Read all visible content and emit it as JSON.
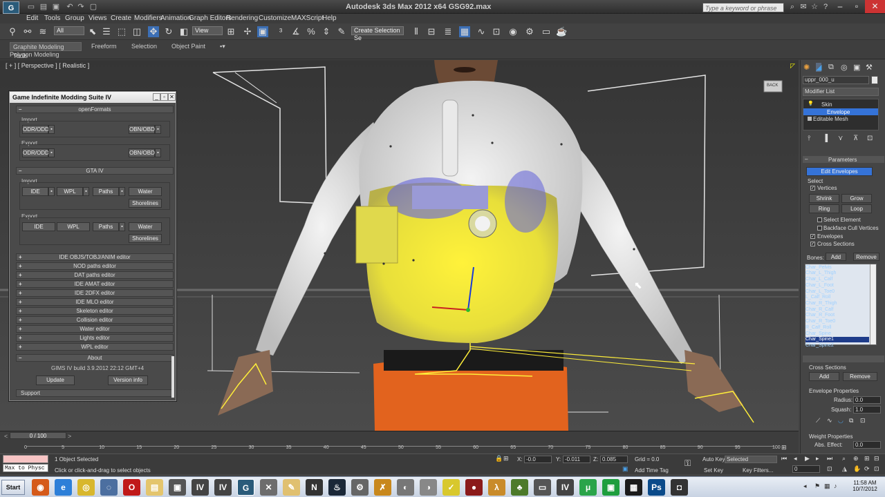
{
  "window": {
    "title": "Autodesk 3ds Max  2012 x64      GSG92.max",
    "app_icon": "3ds-max-logo",
    "search_placeholder": "Type a keyword or phrase"
  },
  "menu": [
    "Edit",
    "Tools",
    "Group",
    "Views",
    "Create",
    "Modifiers",
    "Animation",
    "Graph Editors",
    "Rendering",
    "Customize",
    "MAXScript",
    "Help"
  ],
  "toolbar": {
    "selection_filter": "All",
    "ref_coord": "View",
    "named_selection": "Create Selection Se"
  },
  "ribbon": {
    "tabs": [
      "Graphite Modeling Tools",
      "Freeform",
      "Selection",
      "Object Paint"
    ],
    "sub_label": "Polygon Modeling"
  },
  "viewport": {
    "label": "[ + ] [ Perspective ] [ Realistic ]",
    "viewcube": "BACK"
  },
  "gims_panel": {
    "title": "Game Indefinite Modding Suite IV",
    "open_formats": {
      "header": "openFormats",
      "import_label": "Import",
      "export_label": "Export",
      "import_buttons": [
        "ODR/ODD",
        "OBN/OBD"
      ],
      "export_buttons": [
        "ODR/ODD",
        "OBN/OBD"
      ]
    },
    "gta4": {
      "header": "GTA IV",
      "import_label": "Import",
      "export_label": "Export",
      "import_buttons": [
        "IDE",
        "WPL",
        "Paths",
        "Water",
        "Shorelines"
      ],
      "export_buttons": [
        "IDE",
        "WPL",
        "Paths",
        "Water",
        "Shorelines"
      ]
    },
    "editors": [
      "IDE OBJS/TOBJ/ANIM editor",
      "NOD paths editor",
      "DAT paths editor",
      "IDE AMAT editor",
      "IDE 2DFX editor",
      "IDE MLO editor",
      "Skeleton editor",
      "Collision editor",
      "Water editor",
      "Lights editor",
      "WPL editor"
    ],
    "about": {
      "header": "About",
      "build": "GIMS IV build 3.9.2012 22:12 GMT+4",
      "update": "Update",
      "version": "Version info"
    },
    "support": "Support"
  },
  "command_panel": {
    "object_name": "uppr_000_u",
    "modifier_list": "Modifier List",
    "stack": [
      "Skin",
      "Envelope",
      "Editable Mesh"
    ],
    "parameters": "Parameters",
    "edit_envelopes": "Edit Envelopes",
    "select_label": "Select",
    "vertices": "Vertices",
    "shrink": "Shrink",
    "grow": "Grow",
    "ring": "Ring",
    "loop": "Loop",
    "select_element": "Select Element",
    "backface": "Backface Cull Vertices",
    "envelopes": "Envelopes",
    "cross_sections": "Cross Sections",
    "bones_label": "Bones:",
    "add": "Add",
    "remove": "Remove",
    "bones": [
      "Char_Pelvis",
      "Char_L_Thigh",
      "Char_L_Calf",
      "Char_L_Foot",
      "Char_L_Toe0",
      "L_Calf_Roll",
      "Char_R_Thigh",
      "Char_R_Calf",
      "Char_R_Foot",
      "Char_R_Toe0",
      "R_Calf_Roll",
      "Char_Spine",
      "Char_Spine1",
      "Char_Spine2"
    ],
    "selected_bone": "Char_Spine1",
    "cs_label": "Cross Sections",
    "cs_add": "Add",
    "cs_remove": "Remove",
    "env_props": "Envelope Properties",
    "radius_label": "Radius:",
    "radius_val": "0.0",
    "squash_label": "Squash:",
    "squash_val": "1.0",
    "weight_props": "Weight Properties",
    "abs_effect": "Abs. Effect:",
    "abs_val": "0.0"
  },
  "timeline": {
    "frame": "0 / 100",
    "ticks": [
      "0",
      "5",
      "10",
      "15",
      "20",
      "25",
      "30",
      "35",
      "40",
      "45",
      "50",
      "55",
      "60",
      "65",
      "70",
      "75",
      "80",
      "85",
      "90",
      "95",
      "100"
    ]
  },
  "status": {
    "maxscript": "Max to Physc",
    "selected": "1 Object Selected",
    "prompt": "Click or click-and-drag to select objects",
    "x_label": "X:",
    "x_val": "-0.0",
    "y_label": "Y:",
    "y_val": "-0.011",
    "z_label": "Z:",
    "z_val": "0.085",
    "grid": "Grid = 0.0",
    "add_time_tag": "Add Time Tag",
    "auto_key": "Auto Key",
    "set_key": "Set Key",
    "key_mode": "Selected",
    "key_filters": "Key Filters...",
    "frame_field": "0"
  },
  "taskbar": {
    "start": "Start",
    "time": "11:58 AM",
    "date": "10/7/2012"
  }
}
